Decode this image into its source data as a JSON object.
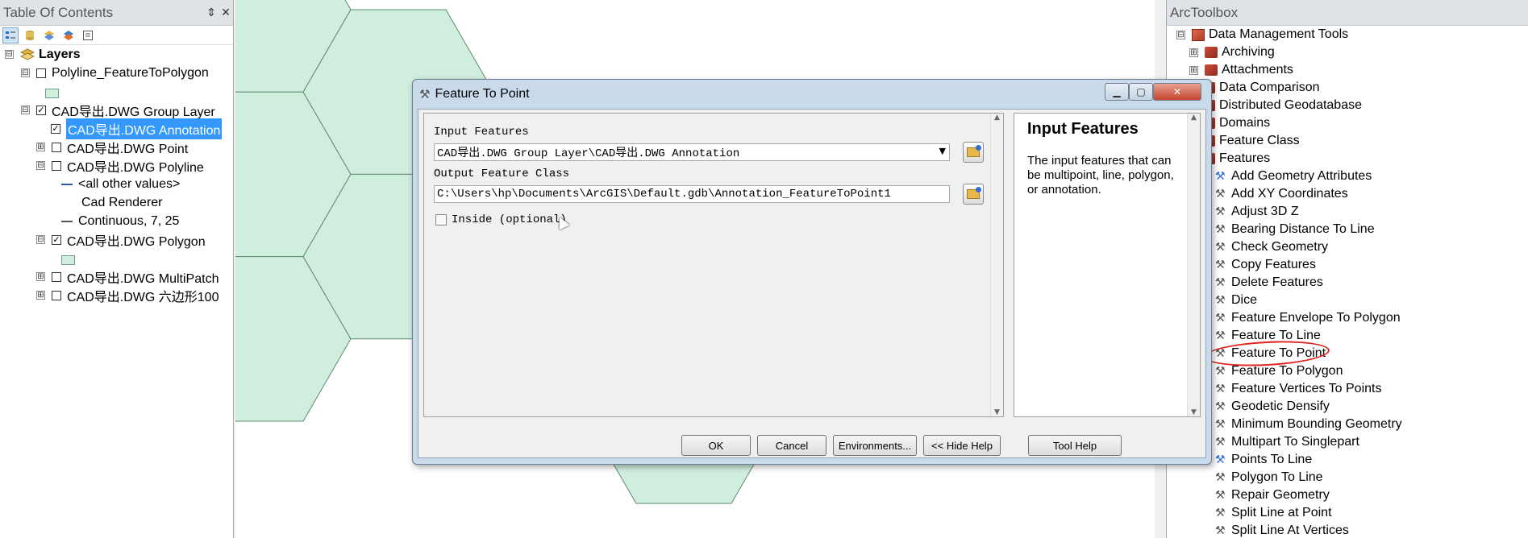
{
  "toc": {
    "title": "Table Of Contents",
    "pin": "⇕",
    "close": "✕",
    "toolbar_icons": [
      "list-by-drawing-order-icon",
      "list-by-source-icon",
      "list-by-visibility-icon",
      "list-by-selection-icon",
      "options-icon"
    ],
    "items": [
      {
        "label": "Layers",
        "exp": "⊟",
        "chk": "",
        "bold": true
      },
      {
        "label": "Polyline_FeatureToPolygon",
        "exp": "⊟",
        "chk": ""
      },
      {
        "label": "CAD导出.DWG Group Layer",
        "exp": "⊟",
        "chk": "✓"
      },
      {
        "label": "CAD导出.DWG Annotation",
        "exp": "",
        "chk": "✓",
        "selected": true
      },
      {
        "label": "CAD导出.DWG Point",
        "exp": "⊞",
        "chk": ""
      },
      {
        "label": "CAD导出.DWG Polyline",
        "exp": "⊟",
        "chk": ""
      },
      {
        "label": "<all other values>"
      },
      {
        "label": "Cad Renderer"
      },
      {
        "label": "Continuous, 7, 25"
      },
      {
        "label": "CAD导出.DWG Polygon",
        "exp": "⊟",
        "chk": "✓"
      },
      {
        "label": "CAD导出.DWG MultiPatch",
        "exp": "⊞",
        "chk": ""
      },
      {
        "label": "CAD导出.DWG 六边形100",
        "exp": "⊞",
        "chk": ""
      }
    ]
  },
  "toolbox": {
    "title": "ArcToolbox",
    "items": [
      {
        "label": "Data Management Tools",
        "exp": "⊟",
        "kind": "box"
      },
      {
        "label": "Archiving",
        "exp": "⊞",
        "kind": "set"
      },
      {
        "label": "Attachments",
        "exp": "⊞",
        "kind": "set"
      },
      {
        "label": "Data Comparison",
        "exp": "",
        "kind": "set"
      },
      {
        "label": "Distributed Geodatabase",
        "exp": "",
        "kind": "set"
      },
      {
        "label": "Domains",
        "exp": "",
        "kind": "set"
      },
      {
        "label": "Feature Class",
        "exp": "",
        "kind": "set"
      },
      {
        "label": "Features",
        "exp": "",
        "kind": "set"
      },
      {
        "label": "Add Geometry Attributes",
        "kind": "script"
      },
      {
        "label": "Add XY Coordinates",
        "kind": "tool"
      },
      {
        "label": "Adjust 3D Z",
        "kind": "tool"
      },
      {
        "label": "Bearing Distance To Line",
        "kind": "tool"
      },
      {
        "label": "Check Geometry",
        "kind": "tool"
      },
      {
        "label": "Copy Features",
        "kind": "tool"
      },
      {
        "label": "Delete Features",
        "kind": "tool"
      },
      {
        "label": "Dice",
        "kind": "tool"
      },
      {
        "label": "Feature Envelope To Polygon",
        "kind": "tool"
      },
      {
        "label": "Feature To Line",
        "kind": "tool"
      },
      {
        "label": "Feature To Point",
        "kind": "tool",
        "highlighted": true
      },
      {
        "label": "Feature To Polygon",
        "kind": "tool"
      },
      {
        "label": "Feature Vertices To Points",
        "kind": "tool"
      },
      {
        "label": "Geodetic Densify",
        "kind": "tool"
      },
      {
        "label": "Minimum Bounding Geometry",
        "kind": "tool"
      },
      {
        "label": "Multipart To Singlepart",
        "kind": "tool"
      },
      {
        "label": "Points To Line",
        "kind": "script"
      },
      {
        "label": "Polygon To Line",
        "kind": "tool"
      },
      {
        "label": "Repair Geometry",
        "kind": "tool"
      },
      {
        "label": "Split Line at Point",
        "kind": "tool"
      },
      {
        "label": "Split Line At Vertices",
        "kind": "tool"
      }
    ]
  },
  "dialog": {
    "title": "Feature To Point",
    "minimize": "▁",
    "maximize": "▢",
    "close": "✕",
    "input_features_label": "Input Features",
    "input_features_value": "CAD导出.DWG Group Layer\\CAD导出.DWG Annotation",
    "output_class_label": "Output Feature Class",
    "output_class_value": "C:\\Users\\hp\\Documents\\ArcGIS\\Default.gdb\\Annotation_FeatureToPoint1",
    "inside_label": "Inside (optional)",
    "inside_checked": false,
    "help_title": "Input Features",
    "help_text": "The input features that can be multipoint, line, polygon, or annotation.",
    "buttons": {
      "ok": "OK",
      "cancel": "Cancel",
      "environments": "Environments...",
      "hide_help": "<< Hide Help",
      "tool_help": "Tool Help"
    }
  },
  "colors": {
    "hex_fill": "#cfeedd",
    "hex_stroke": "#5f8a6f",
    "selection": "#3399ff",
    "annotation_circle": "#e0231c"
  }
}
